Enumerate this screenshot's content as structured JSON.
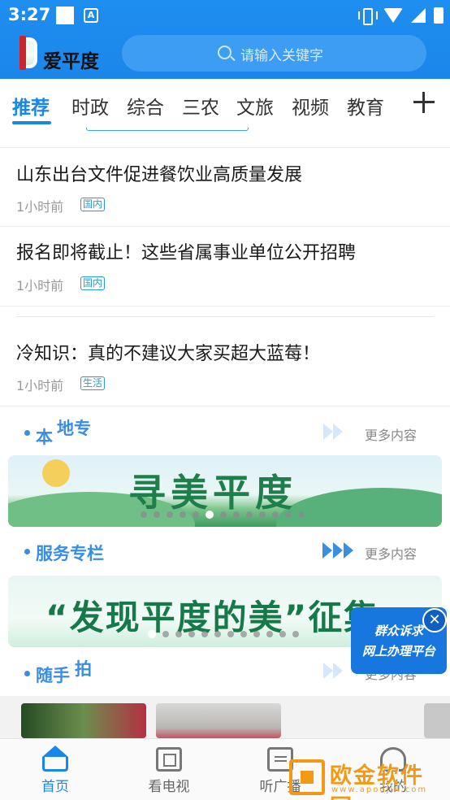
{
  "status_bar": {
    "time": "3:27",
    "app_badge": "A"
  },
  "header": {
    "brand": "爱平度",
    "search_placeholder": "请输入关键字"
  },
  "tabs": [
    {
      "label": "推荐",
      "active": true
    },
    {
      "label": "时政"
    },
    {
      "label": "综合"
    },
    {
      "label": "三农"
    },
    {
      "label": "文旅"
    },
    {
      "label": "视频"
    },
    {
      "label": "教育"
    }
  ],
  "articles": [
    {
      "title": "山东出台文件促进餐饮业高质量发展",
      "time": "1小时前",
      "tag": "国内"
    },
    {
      "title": "报名即将截止！这些省属事业单位公开招聘",
      "time": "1小时前",
      "tag": "国内"
    },
    {
      "title": "冷知识：真的不建议大家买超大蓝莓！",
      "time": "1小时前",
      "tag": "生活"
    }
  ],
  "sections": {
    "local": {
      "title_a": "本",
      "title_b": "地专",
      "more": "更多内容"
    },
    "service": {
      "title": "服务专栏",
      "more": "更多内容"
    },
    "snapshot": {
      "title_a": "随手",
      "title_b": "拍",
      "more": "更多内容"
    }
  },
  "banners": {
    "local_banner": "寻美平度",
    "service_banner": "“发现平度的美”征集"
  },
  "float_card": {
    "line1": "群众诉求",
    "line2": "网上办理平台",
    "close": "✕"
  },
  "bottom_nav": [
    {
      "label": "首页",
      "icon": "home-icon",
      "active": true
    },
    {
      "label": "看电视",
      "icon": "tv-icon"
    },
    {
      "label": "听广播",
      "icon": "radio-icon"
    },
    {
      "label": "我的",
      "icon": "profile-icon"
    }
  ],
  "watermark": {
    "text": "欧金软件园",
    "url": "www.apoujin.com"
  },
  "colors": {
    "primary": "#1b86ea",
    "accent_orange": "#f29a18"
  }
}
